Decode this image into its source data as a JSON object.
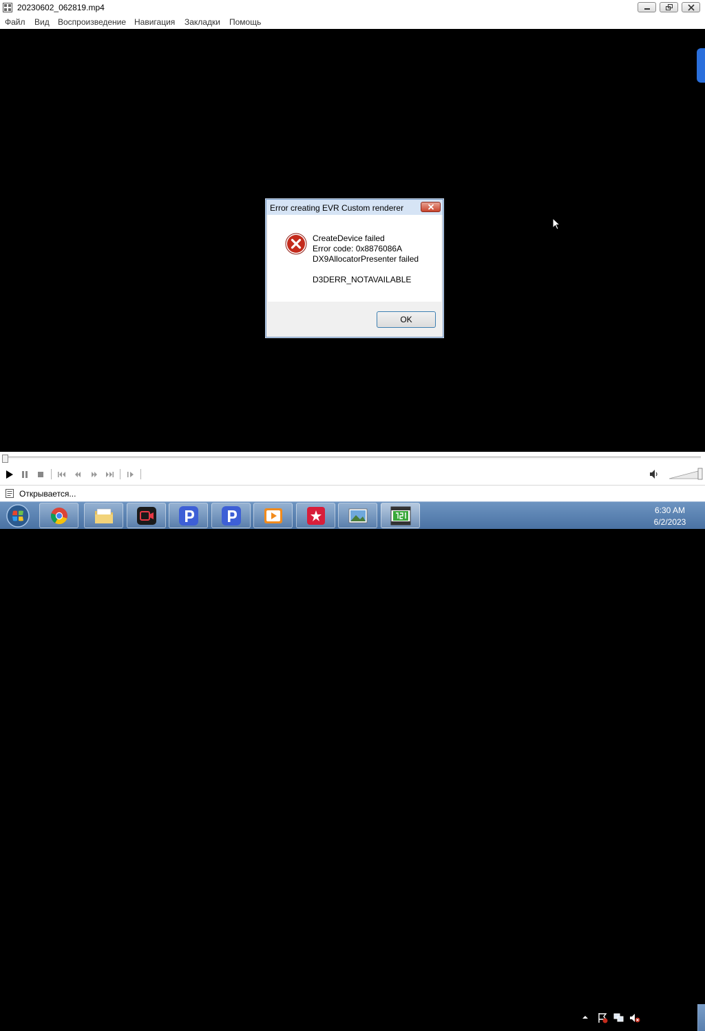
{
  "window": {
    "title": "20230602_062819.mp4"
  },
  "menu": [
    "Файл",
    "Вид",
    "Воспроизведение",
    "Навигация",
    "Закладки",
    "Помощь"
  ],
  "dialog": {
    "title": "Error creating EVR Custom renderer",
    "lines": [
      "CreateDevice failed",
      "Error code: 0x8876086A",
      "DX9AllocatorPresenter failed",
      "",
      "D3DERR_NOTAVAILABLE"
    ],
    "ok_label": "OK"
  },
  "controls": {
    "icons": [
      "play-icon",
      "pause-icon",
      "stop-icon",
      "previous-icon",
      "rewind-icon",
      "fast-forward-icon",
      "next-icon",
      "frame-step-icon",
      "volume-icon"
    ]
  },
  "status": {
    "text": "Открывается..."
  },
  "taskbar": {
    "apps": [
      "chrome",
      "file-explorer",
      "screen-recorder",
      "p-app-1",
      "p-app-2",
      "video-player",
      "video-editor",
      "photo-viewer",
      "media-player-classic"
    ]
  },
  "clock": {
    "time": "6:30 AM",
    "date": "6/2/2023"
  },
  "colors": {
    "video_bg": "#000000",
    "error_red": "#c42b1c",
    "taskbar": "#4a72a3"
  }
}
